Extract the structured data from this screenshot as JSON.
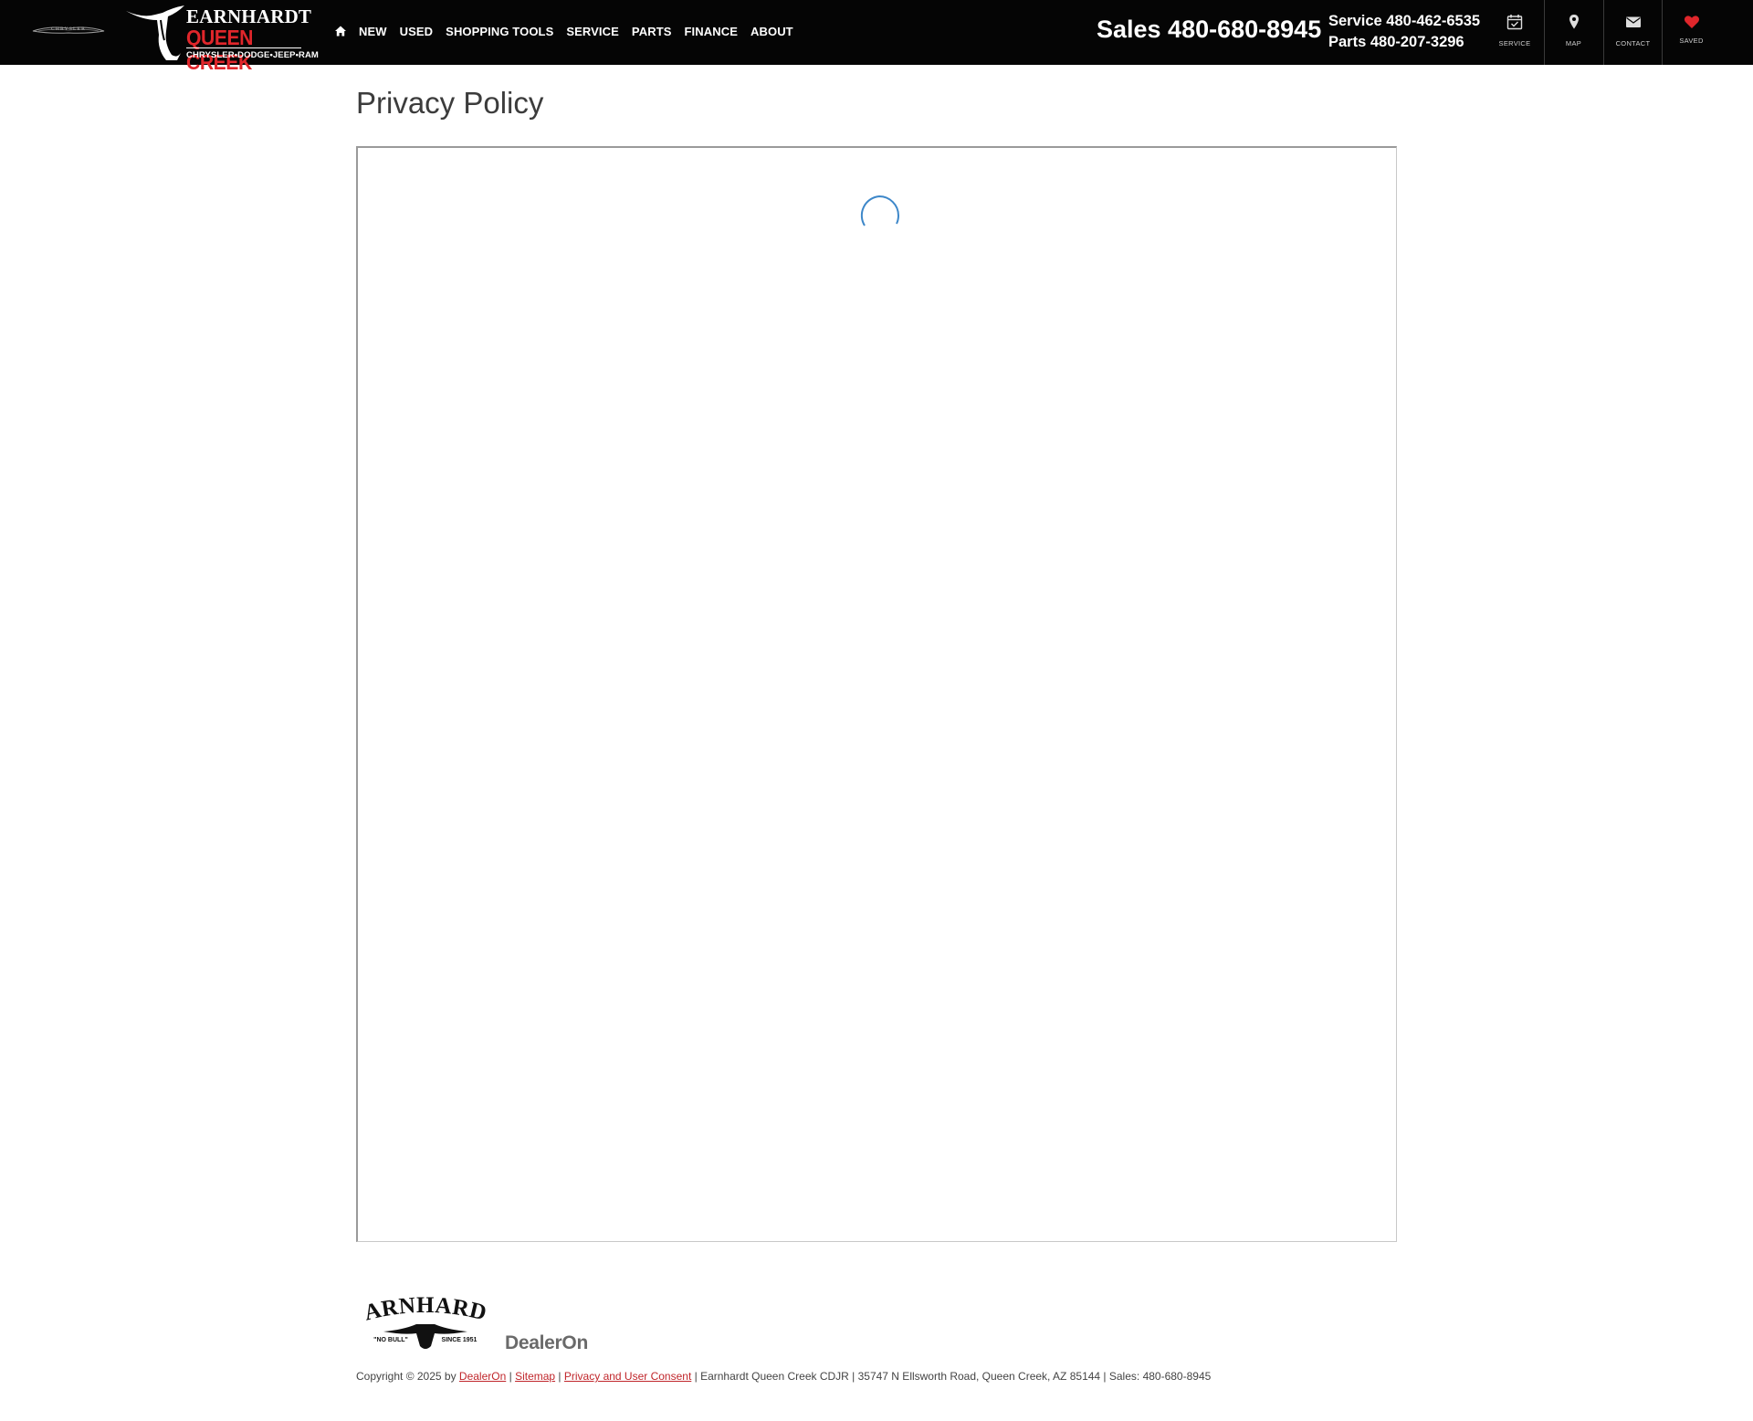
{
  "header": {
    "brand_logo_text": "CHRYSLER",
    "dealer_logo": {
      "line1": "EARNHARDT",
      "line2": "QUEEN CREEK",
      "line3": "CHRYSLER•DODGE•JEEP•RAM"
    },
    "nav": {
      "home_icon": "home-icon",
      "items": [
        "NEW",
        "USED",
        "SHOPPING TOOLS",
        "SERVICE",
        "PARTS",
        "FINANCE",
        "ABOUT"
      ]
    },
    "sales_phone": "Sales 480-680-8945",
    "service_phone": "Service 480-462-6535",
    "parts_phone": "Parts 480-207-3296",
    "quick_links": [
      {
        "label": "SERVICE",
        "icon": "calendar-check-icon"
      },
      {
        "label": "MAP",
        "icon": "map-pin-icon"
      },
      {
        "label": "CONTACT",
        "icon": "envelope-icon"
      },
      {
        "label": "SAVED",
        "icon": "heart-icon"
      }
    ]
  },
  "main": {
    "title": "Privacy Policy",
    "loading_icon": "loading-spinner-icon"
  },
  "footer": {
    "earnhardt_logo": {
      "name": "EARNHARDT",
      "left": "\"NO BULL\"",
      "right": "SINCE 1951"
    },
    "dealeron_logo": "DealerOn",
    "copyright_prefix": "Copyright © 2025 by ",
    "dealeron_link": "DealerOn",
    "sep1": " | ",
    "sitemap_link": "Sitemap",
    "sep2": " | ",
    "privacy_link": "Privacy and User Consent",
    "suffix": " | Earnhardt Queen Creek CDJR | 35747 N Ellsworth Road, Queen Creek, AZ 85144 | Sales: 480-680-8945"
  },
  "colors": {
    "header_bg": "#050505",
    "brand_red": "#e0262b",
    "link_red": "#c0262b",
    "spinner_blue": "#3d87c9"
  }
}
